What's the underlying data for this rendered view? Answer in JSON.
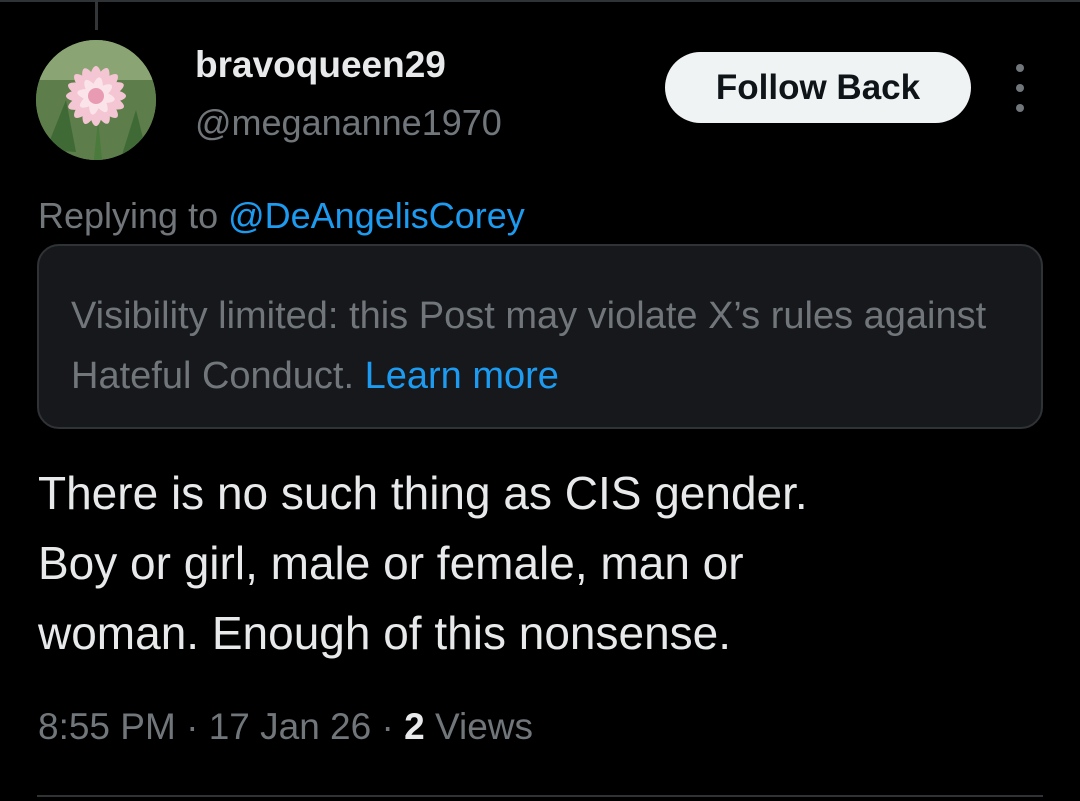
{
  "user": {
    "display_name": "bravoqueen29",
    "handle": "@megananne1970",
    "avatar_icon": "pink-dahlia-flower-avatar"
  },
  "actions": {
    "follow_label": "Follow Back",
    "more_icon": "more-vertical-icon"
  },
  "reply": {
    "prefix": "Replying to ",
    "mention": "@DeAngelisCorey"
  },
  "notice": {
    "text": "Visibility limited: this Post may violate X’s rules against Hateful Conduct. ",
    "link": "Learn more"
  },
  "post": {
    "text": "There is no such thing as CIS gender.\nBoy or girl, male or female, man or\nwoman. Enough of this nonsense."
  },
  "meta": {
    "time": "8:55 PM",
    "sep1": " · ",
    "date": "17 Jan 26",
    "sep2": " · ",
    "views_count": "2",
    "views_label": " Views"
  },
  "colors": {
    "background": "#000000",
    "text_primary": "#e7e9ea",
    "text_secondary": "#71767b",
    "accent_link": "#1d9bf0",
    "notice_bg": "#16181c",
    "button_bg": "#eff3f4"
  }
}
